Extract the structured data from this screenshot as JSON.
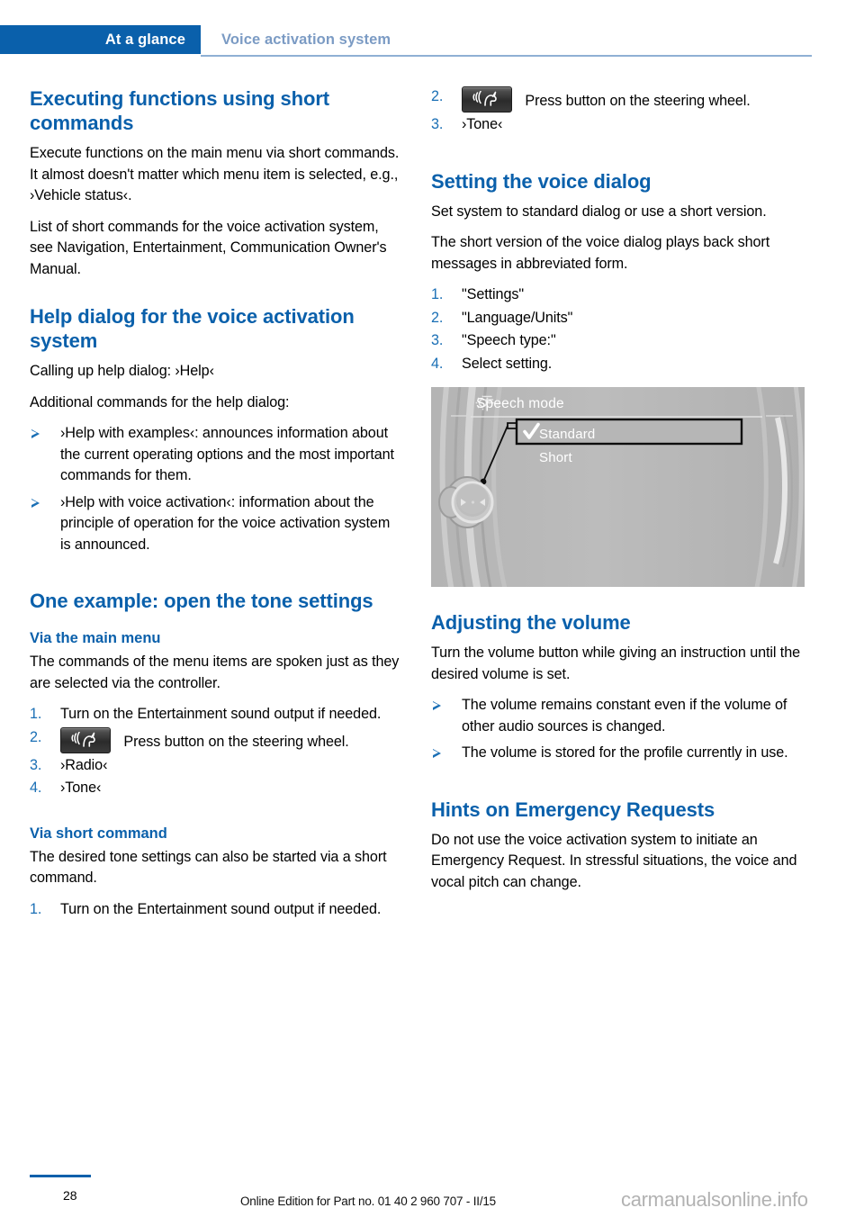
{
  "header": {
    "primary_tab": "At a glance",
    "secondary_tab": "Voice activation system",
    "accent_color": "#0a60ab",
    "secondary_color": "#7b9bc4"
  },
  "left_column": {
    "section1_title": "Executing functions using short commands",
    "section1_para1": "Execute functions on the main menu via short commands. It almost doesn't matter which menu item is selected, e.g., ›Vehicle status‹.",
    "section1_para2": "List of short commands for the voice activation system, see Navigation, Entertainment, Communication Owner's Manual.",
    "section2_title": "Help dialog for the voice activation system",
    "section2_para1": "Calling up help dialog: ›Help‹",
    "section2_para2": "Additional commands for the help dialog:",
    "section2_bullets": [
      "›Help with examples‹: announces information about the current operating options and the most important commands for them.",
      "›Help with voice activation‹: information about the principle of operation for the voice activation system is announced."
    ],
    "section3_title": "One example: open the tone settings",
    "section3_sub1": "Via the main menu",
    "section3_para1": "The commands of the menu items are spoken just as they are selected via the controller.",
    "section3_steps": [
      {
        "num": "1.",
        "text": "Turn on the Entertainment sound output if needed.",
        "icon": null
      },
      {
        "num": "2.",
        "text": "Press button on the steering wheel.",
        "icon": "voice-button-icon"
      },
      {
        "num": "3.",
        "text": "›Radio‹",
        "icon": null
      },
      {
        "num": "4.",
        "text": "›Tone‹",
        "icon": null
      }
    ],
    "section3_sub2": "Via short command",
    "section3_para2": "The desired tone settings can also be started via a short command.",
    "section3_steps2": [
      {
        "num": "1.",
        "text": "Turn on the Entertainment sound output if needed.",
        "icon": null
      }
    ]
  },
  "right_column": {
    "cont_steps": [
      {
        "num": "2.",
        "text": "Press button on the steering wheel.",
        "icon": "voice-button-icon"
      },
      {
        "num": "3.",
        "text": "›Tone‹",
        "icon": null
      }
    ],
    "section4_title": "Setting the voice dialog",
    "section4_para1": "Set system to standard dialog or use a short version.",
    "section4_para2": "The short version of the voice dialog plays back short messages in abbreviated form.",
    "section4_steps": [
      {
        "num": "1.",
        "text": "\"Settings\"",
        "icon": null
      },
      {
        "num": "2.",
        "text": "\"Language/Units\"",
        "icon": null
      },
      {
        "num": "3.",
        "text": "\"Speech type:\"",
        "icon": null
      },
      {
        "num": "4.",
        "text": "Select setting.",
        "icon": null
      }
    ],
    "figure": {
      "title": "Speech mode",
      "title_icon": "gear-settings-icon",
      "option_selected": "Standard",
      "option_selected_mark": "check-icon",
      "option_other": "Short",
      "controller_icon": "idrive-controller-icon"
    },
    "section5_title": "Adjusting the volume",
    "section5_para1": "Turn the volume button while giving an instruction until the desired volume is set.",
    "section5_bullets": [
      "The volume remains constant even if the volume of other audio sources is changed.",
      "The volume is stored for the profile currently in use."
    ],
    "section6_title": "Hints on Emergency Requests",
    "section6_para1": "Do not use the voice activation system to initiate an Emergency Request. In stressful situations, the voice and vocal pitch can change."
  },
  "footer": {
    "page_number": "28",
    "edition": "Online Edition for Part no. 01 40 2 960 707 - II/15",
    "watermark": "carmanualsonline.info"
  }
}
